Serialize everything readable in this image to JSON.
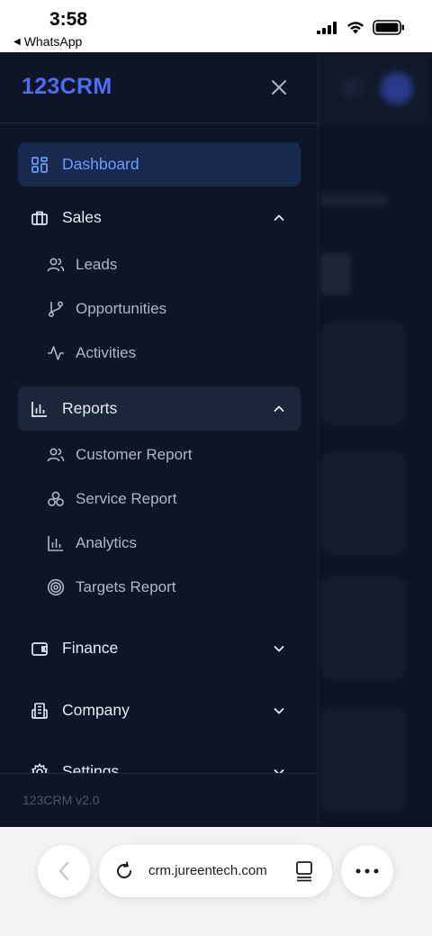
{
  "status_bar": {
    "time": "3:58",
    "back_app": "WhatsApp"
  },
  "drawer": {
    "brand": "123CRM",
    "footer_version": "123CRM v2.0",
    "nav": {
      "dashboard": "Dashboard",
      "sales": "Sales",
      "sales_sub": [
        "Leads",
        "Opportunities",
        "Activities"
      ],
      "reports": "Reports",
      "reports_sub": [
        "Customer Report",
        "Service Report",
        "Analytics",
        "Targets Report"
      ],
      "finance": "Finance",
      "company": "Company",
      "settings": "Settings"
    },
    "icons": {
      "dashboard": "layout-grid-icon",
      "sales": "briefcase-icon",
      "leads": "users-icon",
      "opportunities": "git-branch-icon",
      "activities": "activity-icon",
      "reports": "bar-chart-icon",
      "customer_report": "users-icon",
      "service_report": "circles-icon",
      "analytics": "bar-chart-icon",
      "targets_report": "target-icon",
      "finance": "wallet-icon",
      "company": "building-icon",
      "settings": "gear-icon",
      "close": "close-icon"
    }
  },
  "browser": {
    "url": "crm.jureentech.com"
  },
  "colors": {
    "accent": "#4c6ef5",
    "active_text": "#6a9bff",
    "drawer_bg": "#0d1526"
  }
}
